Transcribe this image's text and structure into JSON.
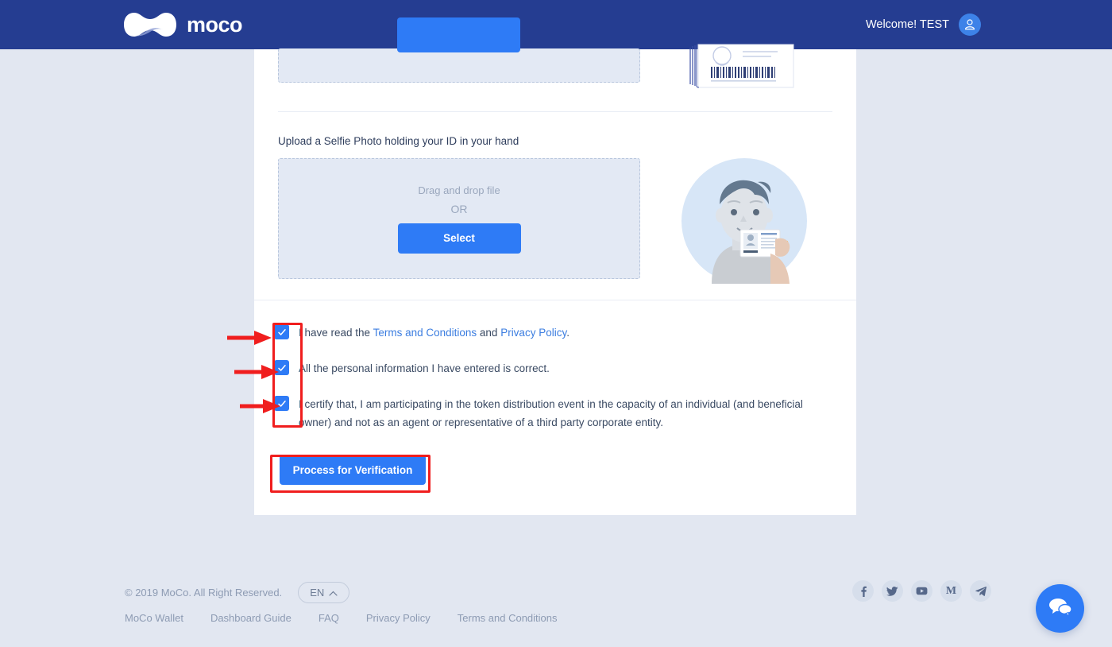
{
  "header": {
    "brand_name": "moco",
    "welcome_text": "Welcome! TEST",
    "logo_icon": "moco-wave-logo",
    "avatar_icon": "user-avatar-icon",
    "bar_color": "#253d91"
  },
  "upload_top": {
    "button_label": "",
    "id_card_illustration": "id-card-barcode-illustration"
  },
  "selfie_section": {
    "label": "Upload a Selfie Photo holding your ID in your hand",
    "drag_hint": "Drag and drop file",
    "or_text": "OR",
    "select_label": "Select",
    "illustration": "person-holding-id-card-illustration"
  },
  "consents": [
    {
      "checked": true,
      "segments": [
        {
          "text": "I have read the ",
          "link": false
        },
        {
          "text": "Terms and Conditions",
          "link": true
        },
        {
          "text": " and ",
          "link": false
        },
        {
          "text": "Privacy Policy",
          "link": true
        },
        {
          "text": ".",
          "link": false
        }
      ],
      "plain": "I have read the Terms and Conditions and Privacy Policy."
    },
    {
      "checked": true,
      "plain": "All the personal information I have entered is correct."
    },
    {
      "checked": true,
      "plain": "I certify that, I am participating in the token distribution event in the capacity of an individual (and beneficial owner) and not as an agent or representative of a third party corporate entity."
    }
  ],
  "consent_links": {
    "terms": "Terms and Conditions",
    "privacy": "Privacy Policy"
  },
  "submit": {
    "label": "Process for Verification"
  },
  "annotations": {
    "highlight_color": "#f01e1e",
    "arrow_count": 3
  },
  "footer": {
    "copyright": "© 2019 MoCo. All Right Reserved.",
    "language": "EN",
    "language_caret": "chevron-up-icon",
    "links": [
      {
        "label": "MoCo Wallet"
      },
      {
        "label": "Dashboard Guide"
      },
      {
        "label": "FAQ"
      },
      {
        "label": "Privacy Policy"
      },
      {
        "label": "Terms and Conditions"
      }
    ],
    "socials": [
      {
        "name": "facebook-icon",
        "glyph": "f"
      },
      {
        "name": "twitter-icon",
        "glyph": ""
      },
      {
        "name": "youtube-icon",
        "glyph": ""
      },
      {
        "name": "medium-icon",
        "glyph": "M"
      },
      {
        "name": "telegram-icon",
        "glyph": ""
      }
    ]
  },
  "chat": {
    "icon": "chat-bubbles-icon",
    "color": "#2e7bf6"
  },
  "theme": {
    "page_background": "#e2e7f1",
    "card_background": "#ffffff",
    "primary_blue": "#2e7bf6",
    "link_blue": "#3b7de0",
    "muted_text": "#8d9bb3"
  }
}
